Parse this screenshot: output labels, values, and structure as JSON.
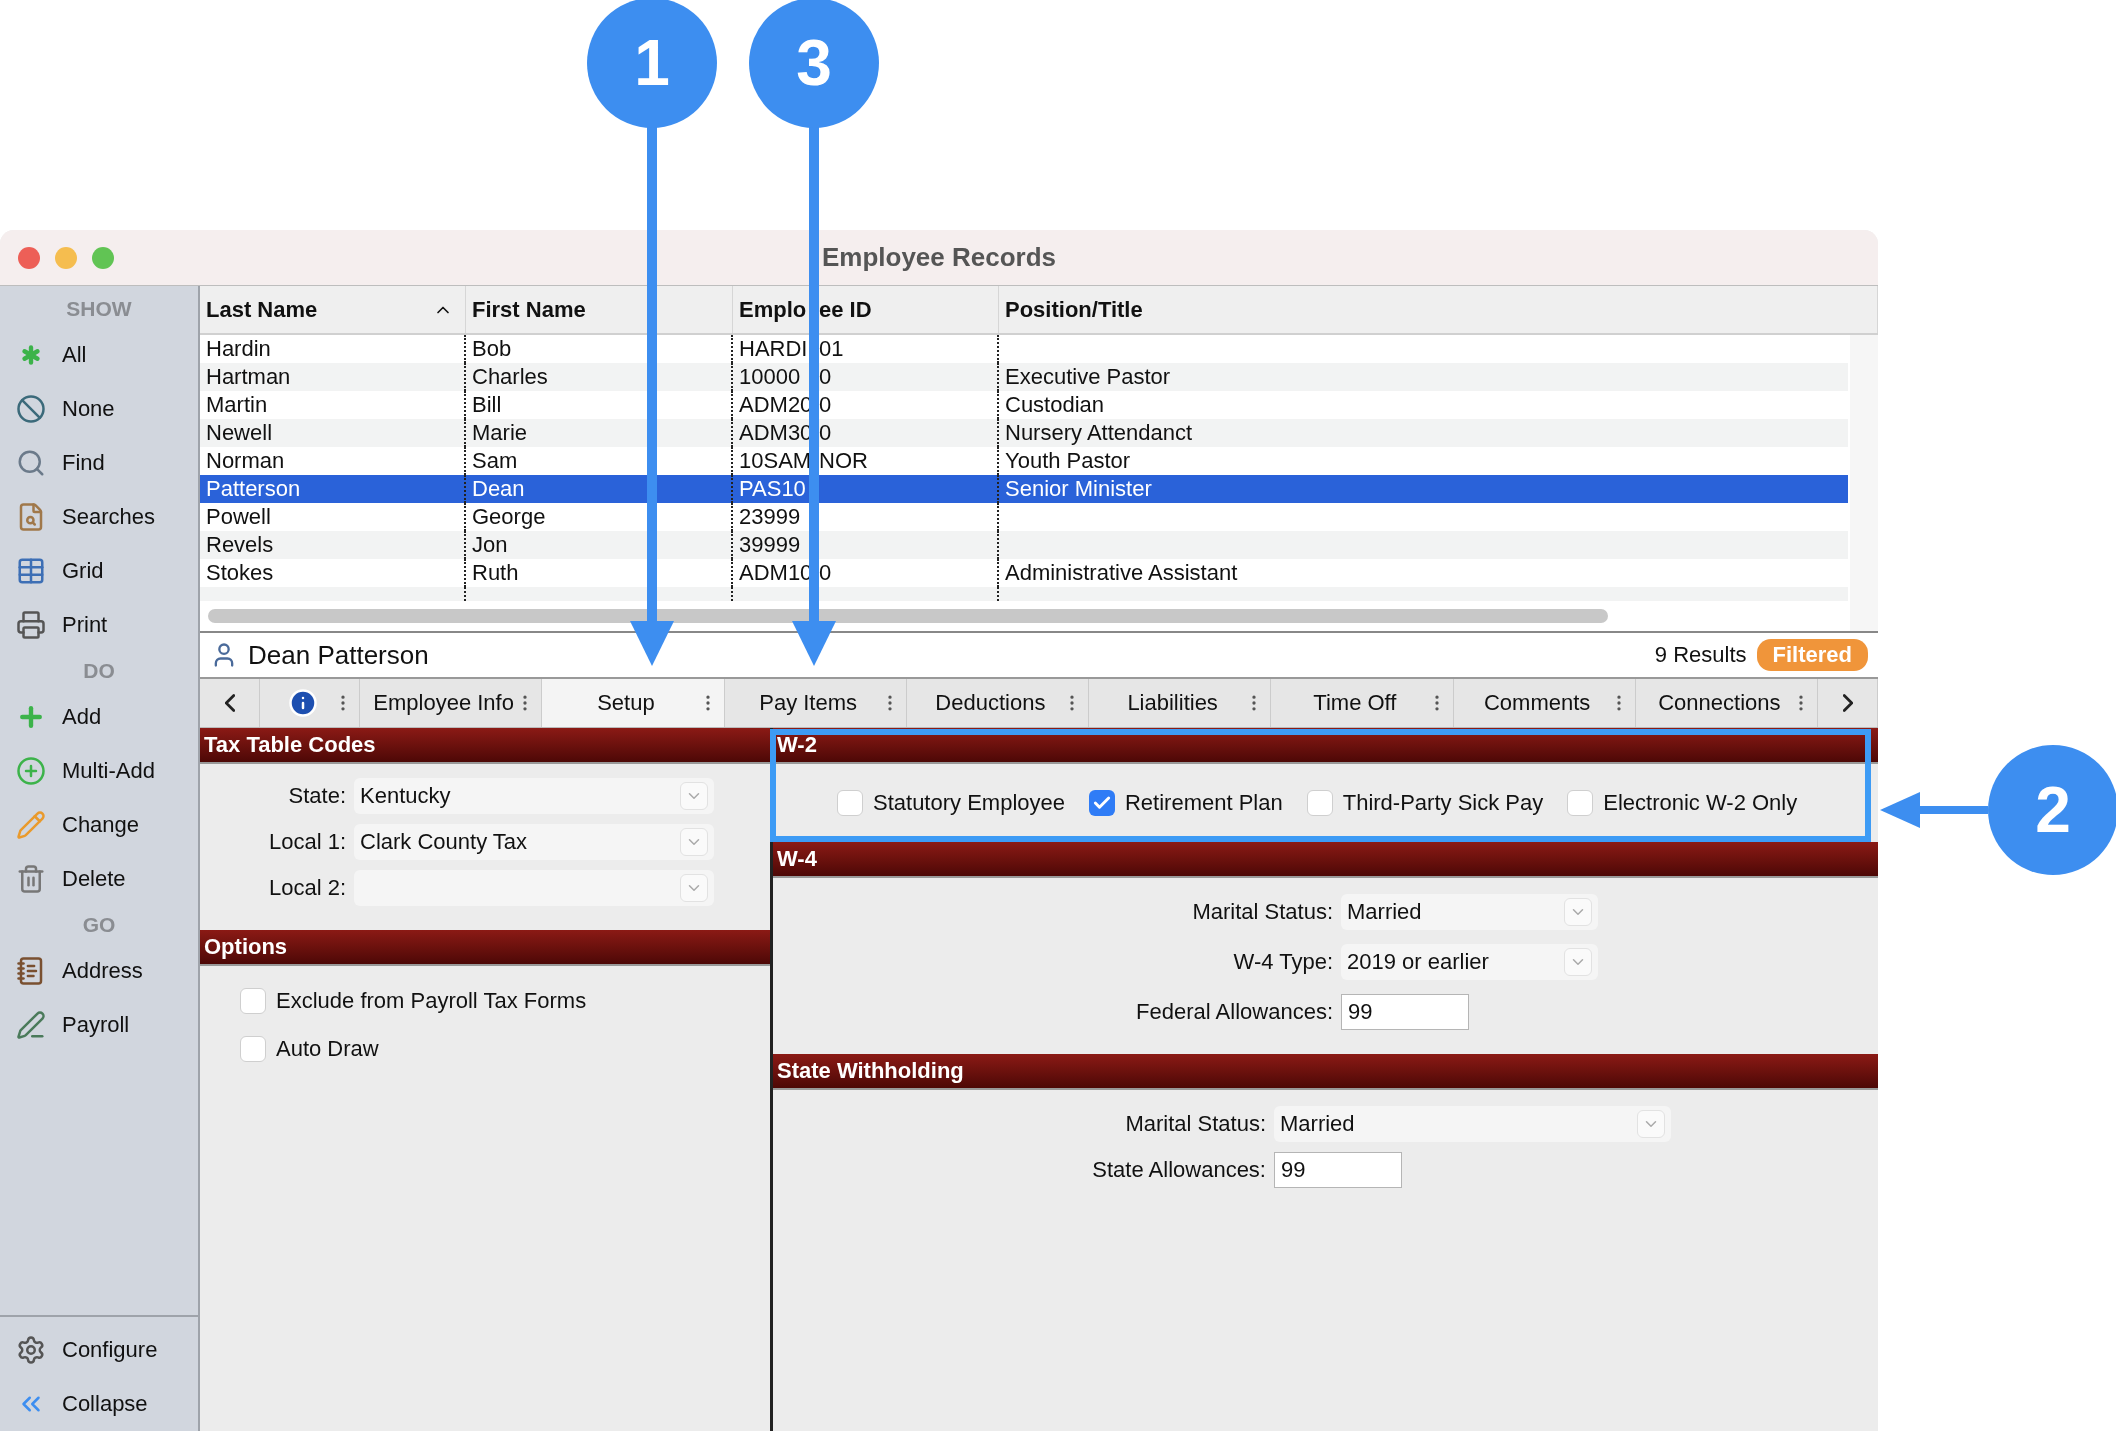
{
  "window": {
    "title": "Employee Records"
  },
  "sidebar": {
    "sections": [
      {
        "heading": "SHOW",
        "items": [
          {
            "label": "All"
          },
          {
            "label": "None"
          },
          {
            "label": "Find"
          },
          {
            "label": "Searches"
          },
          {
            "label": "Grid"
          },
          {
            "label": "Print"
          }
        ]
      },
      {
        "heading": "DO",
        "items": [
          {
            "label": "Add"
          },
          {
            "label": "Multi-Add"
          },
          {
            "label": "Change"
          },
          {
            "label": "Delete"
          }
        ]
      },
      {
        "heading": "GO",
        "items": [
          {
            "label": "Address"
          },
          {
            "label": "Payroll"
          }
        ]
      }
    ],
    "bottom_items": [
      {
        "label": "Configure"
      },
      {
        "label": "Collapse"
      }
    ]
  },
  "table": {
    "columns": [
      {
        "label": "Last Name",
        "sorted": true
      },
      {
        "label": "First Name",
        "sorted": false
      },
      {
        "label": "Emplo",
        "label_tail": "ee ID",
        "sorted": false
      },
      {
        "label": "Position/Title",
        "sorted": false
      }
    ],
    "rows": [
      {
        "last": "Hardin",
        "first": "Bob",
        "id": "HARDI",
        "id_tail": "01",
        "selected": false
      },
      {
        "last": "Hartman",
        "first": "Charles",
        "id": "10000",
        "id_tail": "0",
        "position": "Executive Pastor",
        "selected": false
      },
      {
        "last": "Martin",
        "first": "Bill",
        "id": "ADM20",
        "id_tail": "0",
        "position": "Custodian",
        "selected": false
      },
      {
        "last": "Newell",
        "first": "Marie",
        "id": "ADM30",
        "id_tail": "0",
        "position": "Nursery Attendanct",
        "selected": false
      },
      {
        "last": "Norman",
        "first": "Sam",
        "id": "10SAM",
        "id_tail": "NOR",
        "position": "Youth Pastor",
        "selected": false
      },
      {
        "last": "Patterson",
        "first": "Dean",
        "id": "PAS10",
        "position": "Senior Minister",
        "selected": true
      },
      {
        "last": "Powell",
        "first": "George",
        "id": "23999",
        "selected": false
      },
      {
        "last": "Revels",
        "first": "Jon",
        "id": "39999",
        "selected": false
      },
      {
        "last": "Stokes",
        "first": "Ruth",
        "id": "ADM10",
        "id_tail": "0",
        "position": "Administrative Assistant",
        "selected": false
      }
    ]
  },
  "record_bar": {
    "name": "Dean Patterson",
    "results": "9 Results",
    "badge": "Filtered"
  },
  "tabs": [
    {
      "kind": "info",
      "selected": false
    },
    {
      "kind": "text",
      "label": "Employee Info",
      "selected": false
    },
    {
      "kind": "text",
      "label": "Setup",
      "selected": true
    },
    {
      "kind": "text",
      "label": "Pay Items",
      "selected": false
    },
    {
      "kind": "text",
      "label": "Deductions",
      "selected": false
    },
    {
      "kind": "text",
      "label": "Liabilities",
      "selected": false
    },
    {
      "kind": "text",
      "label": "Time Off",
      "selected": false
    },
    {
      "kind": "text",
      "label": "Comments",
      "selected": false
    },
    {
      "kind": "text",
      "label": "Connections",
      "selected": false
    }
  ],
  "left_panel": [
    {
      "title": "Tax Table Codes",
      "kind": "fields",
      "fields": [
        {
          "kind": "select",
          "label": "State:",
          "value": "Kentucky"
        },
        {
          "kind": "select",
          "label": "Local 1:",
          "value": "Clark County Tax"
        },
        {
          "kind": "select",
          "label": "Local 2:"
        }
      ]
    },
    {
      "title": "Options",
      "kind": "checks",
      "checks": [
        {
          "label": "Exclude from Payroll Tax Forms",
          "checked": false
        },
        {
          "label": "Auto Draw",
          "checked": false
        }
      ]
    }
  ],
  "right_panel": [
    {
      "title": "W-2",
      "kind": "inline_checks",
      "checks": [
        {
          "label": "Statutory Employee",
          "checked": false
        },
        {
          "label": "Retirement Plan",
          "checked": true
        },
        {
          "label": "Third-Party Sick Pay",
          "checked": false
        },
        {
          "label": "Electronic W-2 Only",
          "checked": false
        }
      ]
    },
    {
      "title": "W-4",
      "kind": "fields",
      "fields": [
        {
          "kind": "select",
          "label": "Marital Status:",
          "value": "Married"
        },
        {
          "kind": "select",
          "label": "W-4 Type:",
          "value": "2019 or earlier"
        },
        {
          "kind": "input",
          "label": "Federal Allowances:",
          "value": "99"
        }
      ]
    },
    {
      "title": "State Withholding",
      "kind": "fields",
      "fields": [
        {
          "kind": "select",
          "label": "Marital Status:",
          "value": "Married"
        },
        {
          "kind": "input",
          "label": "State Allowances:",
          "value": "99"
        }
      ]
    }
  ],
  "callouts": [
    {
      "label": "1"
    },
    {
      "label": "3"
    },
    {
      "label": "2"
    }
  ]
}
